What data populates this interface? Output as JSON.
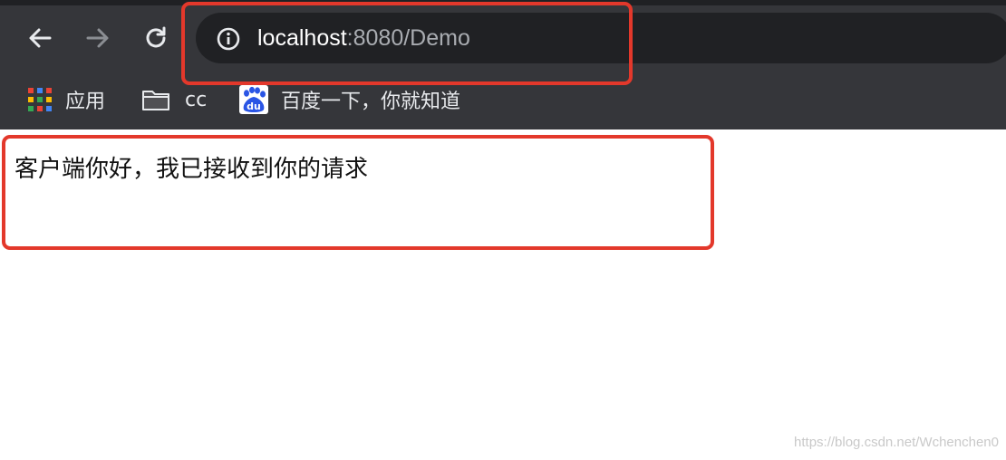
{
  "browser": {
    "url_host": "localhost",
    "url_path": ":8080/Demo",
    "bookmarks": [
      {
        "label": "应用",
        "icon": "apps-grid-icon"
      },
      {
        "label": "cc",
        "icon": "folder-icon"
      },
      {
        "label": "百度一下，你就知道",
        "icon": "baidu-icon"
      }
    ]
  },
  "page": {
    "response_text": "客户端你好，我已接收到你的请求"
  },
  "watermark": "https://blog.csdn.net/Wchenchen0",
  "colors": {
    "chrome_bg": "#35363a",
    "omnibox_bg": "#202124",
    "highlight": "#e3382b",
    "baidu_blue": "#2a55e5"
  }
}
